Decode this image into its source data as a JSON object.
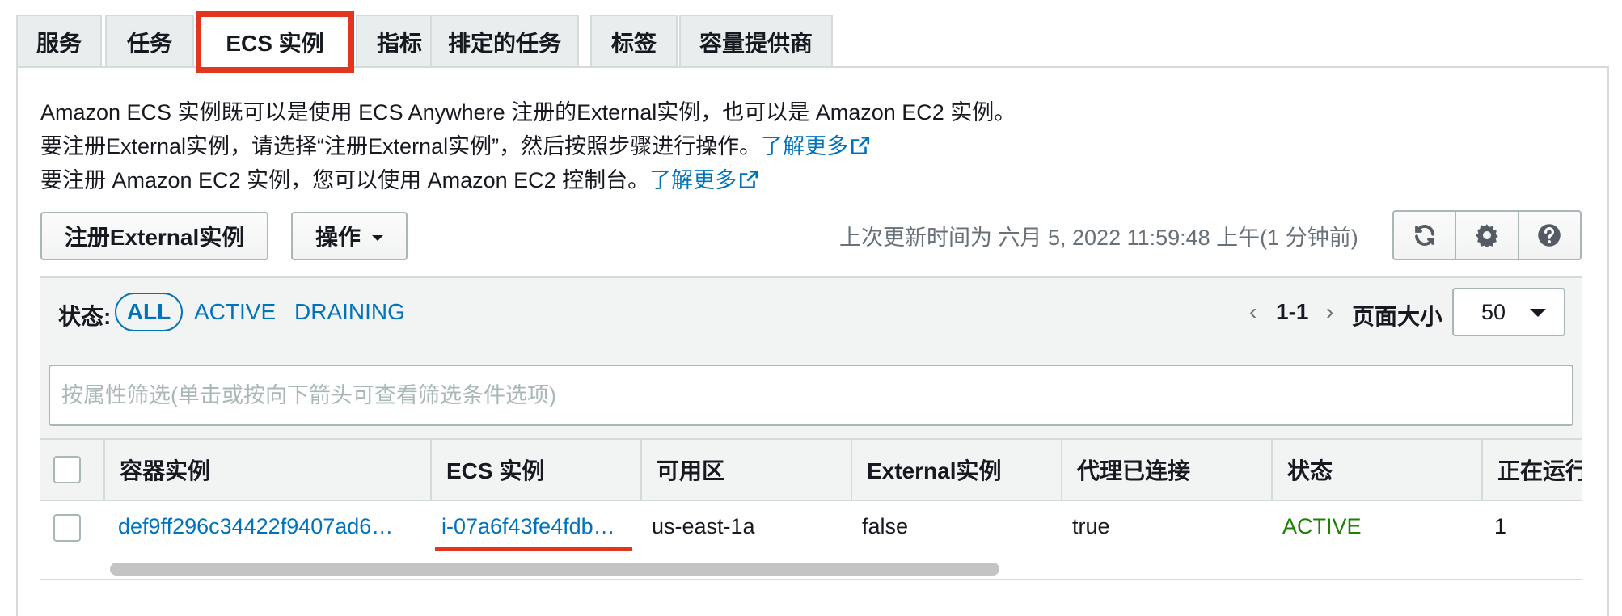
{
  "tabs": [
    {
      "label": "服务"
    },
    {
      "label": "任务"
    },
    {
      "label": "ECS 实例"
    },
    {
      "label": "指标"
    },
    {
      "label": "排定的任务"
    },
    {
      "label": "标签"
    },
    {
      "label": "容量提供商"
    }
  ],
  "intro": {
    "line1": "Amazon ECS 实例既可以是使用 ECS Anywhere 注册的External实例，也可以是 Amazon EC2 实例。",
    "line2": "要注册External实例，请选择“注册External实例”，然后按照步骤进行操作。",
    "line2_link": "了解更多",
    "line3": "要注册 Amazon EC2 实例，您可以使用 Amazon EC2 控制台。",
    "line3_link": "了解更多"
  },
  "toolbar": {
    "register_label": "注册External实例",
    "actions_label": "操作",
    "updated_text": "上次更新时间为 六月 5, 2022 11:59:48 上午(1 分钟前)"
  },
  "filters": {
    "status_label": "状态:",
    "all": "ALL",
    "active": "ACTIVE",
    "draining": "DRAINING"
  },
  "pager": {
    "range": "1-1",
    "page_size_label": "页面大小",
    "page_size": "50"
  },
  "search": {
    "placeholder": "按属性筛选(单击或按向下箭头可查看筛选条件选项)"
  },
  "table": {
    "headers": [
      "容器实例",
      "ECS 实例",
      "可用区",
      "External实例",
      "代理已连接",
      "状态",
      "正在运行"
    ],
    "rows": [
      {
        "container_instance": "def9ff296c34422f9407ad6…",
        "ecs_instance": "i-07a6f43fe4fdb…",
        "az": "us-east-1a",
        "external": "false",
        "agent_connected": "true",
        "status": "ACTIVE",
        "running": "1"
      }
    ]
  },
  "colors": {
    "link": "#0073bb",
    "highlight": "#e2361e",
    "active_status": "#1d8102"
  }
}
